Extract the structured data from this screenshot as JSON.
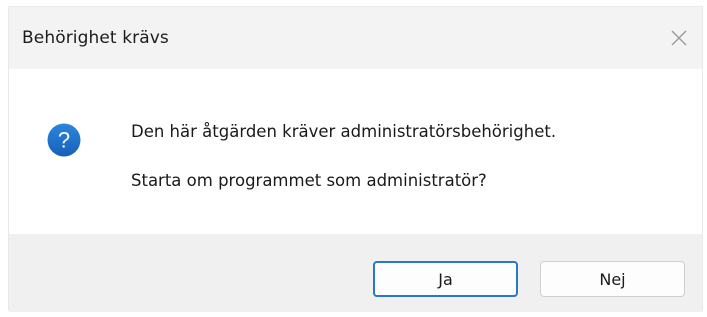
{
  "window": {
    "title": "Behörighet krävs",
    "close_icon": "close-icon"
  },
  "message": {
    "icon": "question-icon",
    "icon_color": "#1f6fc7",
    "line1": "Den här åtgärden kräver administratörsbehörighet.",
    "line2": "Starta om programmet som administratör?"
  },
  "buttons": {
    "yes_label": "Ja",
    "no_label": "Nej",
    "default_accent": "#2a77c9"
  }
}
